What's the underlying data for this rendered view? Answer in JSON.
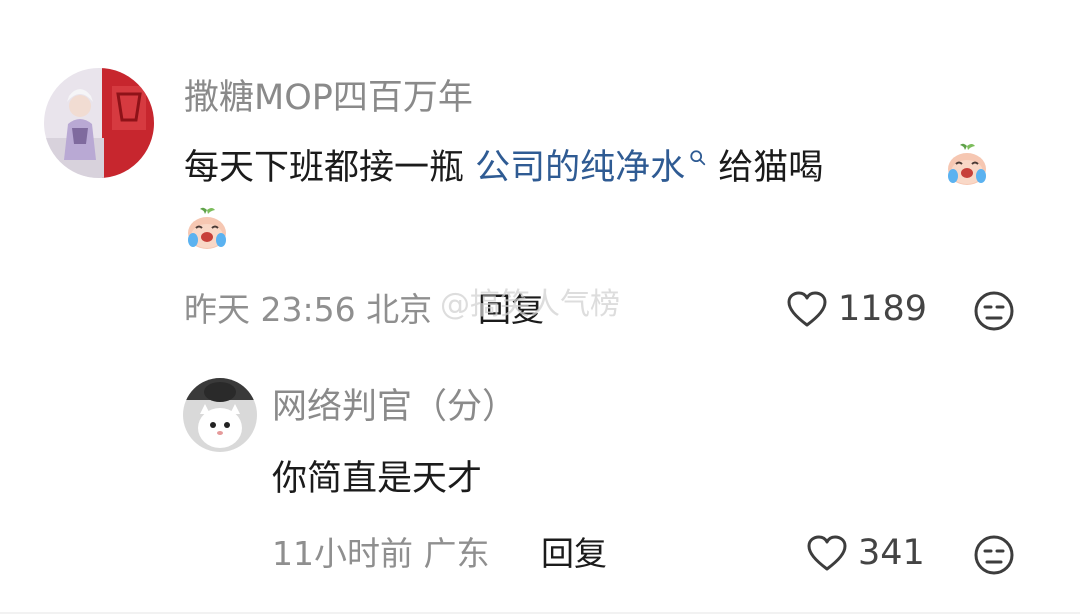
{
  "comment": {
    "username": "撒糖MOP四百万年",
    "text_prefix": "每天下班都接一瓶 ",
    "text_link": "公司的纯净水",
    "text_suffix": " 给猫喝",
    "time": "昨天 23:56",
    "location": "北京",
    "reply_label": "回复",
    "likes": "1189"
  },
  "reply": {
    "username": "网络判官（分）",
    "text": "你简直是天才",
    "time": "11小时前",
    "location": "广东",
    "reply_label": "回复",
    "likes": "341"
  },
  "watermark": "@搞笑人气榜",
  "colors": {
    "link": "#2f5b93",
    "meta": "#8f8f8f",
    "text": "#1b1b1b"
  },
  "icons": [
    "heart-outline-icon",
    "unhappy-face-icon",
    "search-icon",
    "crying-peach-emoji"
  ]
}
